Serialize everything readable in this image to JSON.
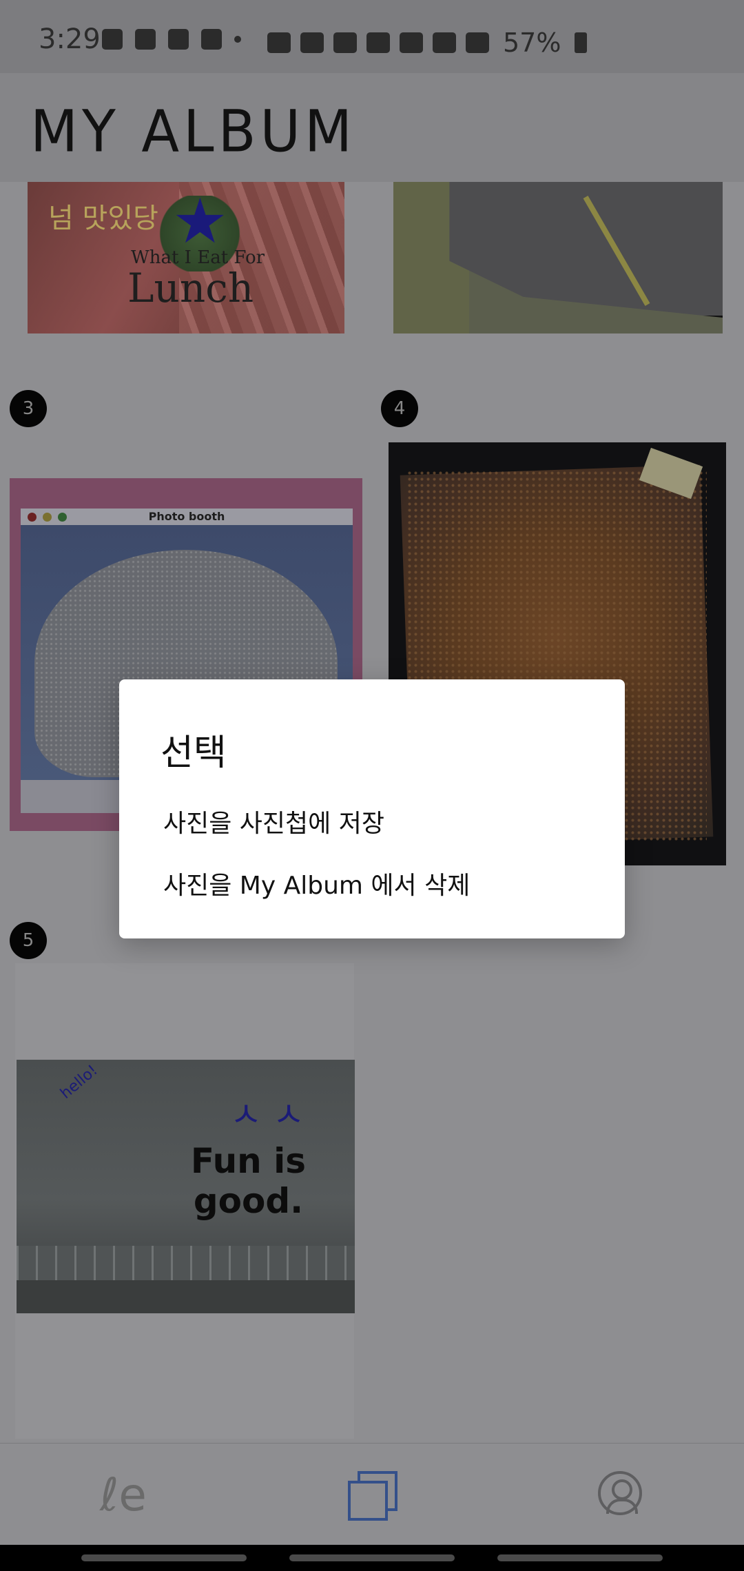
{
  "status_bar": {
    "time": "3:29",
    "battery": "57%"
  },
  "app_bar": {
    "title": "MY ALBUM"
  },
  "photos": [
    {
      "text_overlay": "넘 맛있당",
      "caption_small": "What I Eat For",
      "caption_large": "Lunch"
    },
    {
      "text_overlay": ""
    },
    {
      "badge": "3",
      "window_title": "Photo booth"
    },
    {
      "badge": "4"
    },
    {
      "badge": "5",
      "handwriting": "hello!",
      "caption": "Fun is good.",
      "squiggle": "ㅅ ㅅ"
    }
  ],
  "dialog": {
    "title": "선택",
    "options": [
      {
        "label": "사진을 사진첩에 저장"
      },
      {
        "label": "사진을 My Album 에서 삭제"
      }
    ]
  },
  "bottom_nav": {
    "items": [
      {
        "icon": "handwriting-icon",
        "glyph": "ℓe"
      },
      {
        "icon": "album-icon",
        "active": true
      },
      {
        "icon": "profile-icon"
      }
    ]
  }
}
